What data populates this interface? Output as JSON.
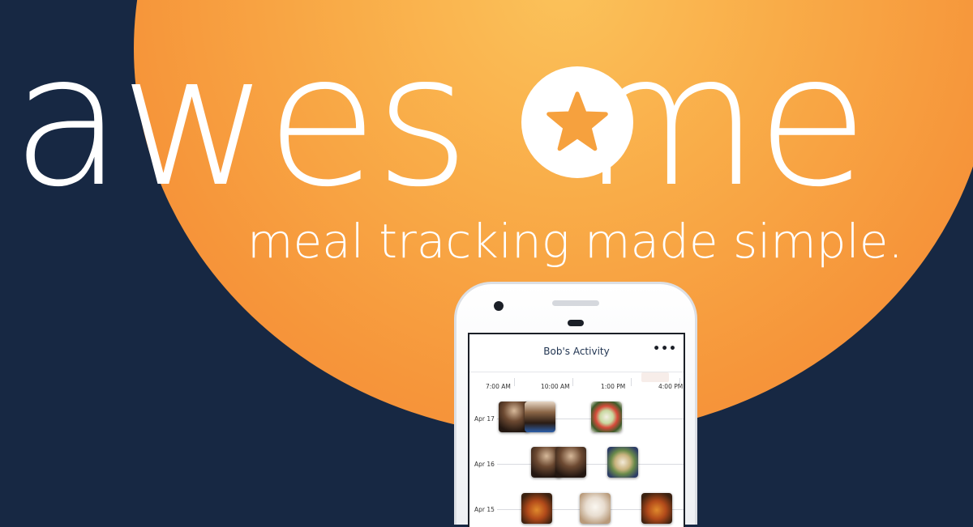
{
  "brand": {
    "headline_before_o": "awes",
    "headline_after_o": "me",
    "o_icon": "star-icon",
    "tagline": "meal tracking made simple.",
    "colors": {
      "background": "#172843",
      "sun": "#f9ac48",
      "star": "#f6a13e",
      "text": "#ffffff"
    }
  },
  "app": {
    "title": "Bob's Activity",
    "more_icon": "more-horizontal-icon",
    "more_label": "•••",
    "time_axis": [
      "7:00 AM",
      "10:00 AM",
      "1:00 PM",
      "4:00 PM"
    ],
    "days": [
      {
        "date": "Apr 17",
        "meals": [
          "coffee-photo",
          "coffee-photo",
          "salad-photo"
        ]
      },
      {
        "date": "Apr 16",
        "meals": [
          "coffee-photo",
          "coffee-photo",
          "bowl-photo"
        ]
      },
      {
        "date": "Apr 15",
        "meals": [
          "curry-photo",
          "rice-photo",
          "curry-photo"
        ]
      }
    ]
  }
}
